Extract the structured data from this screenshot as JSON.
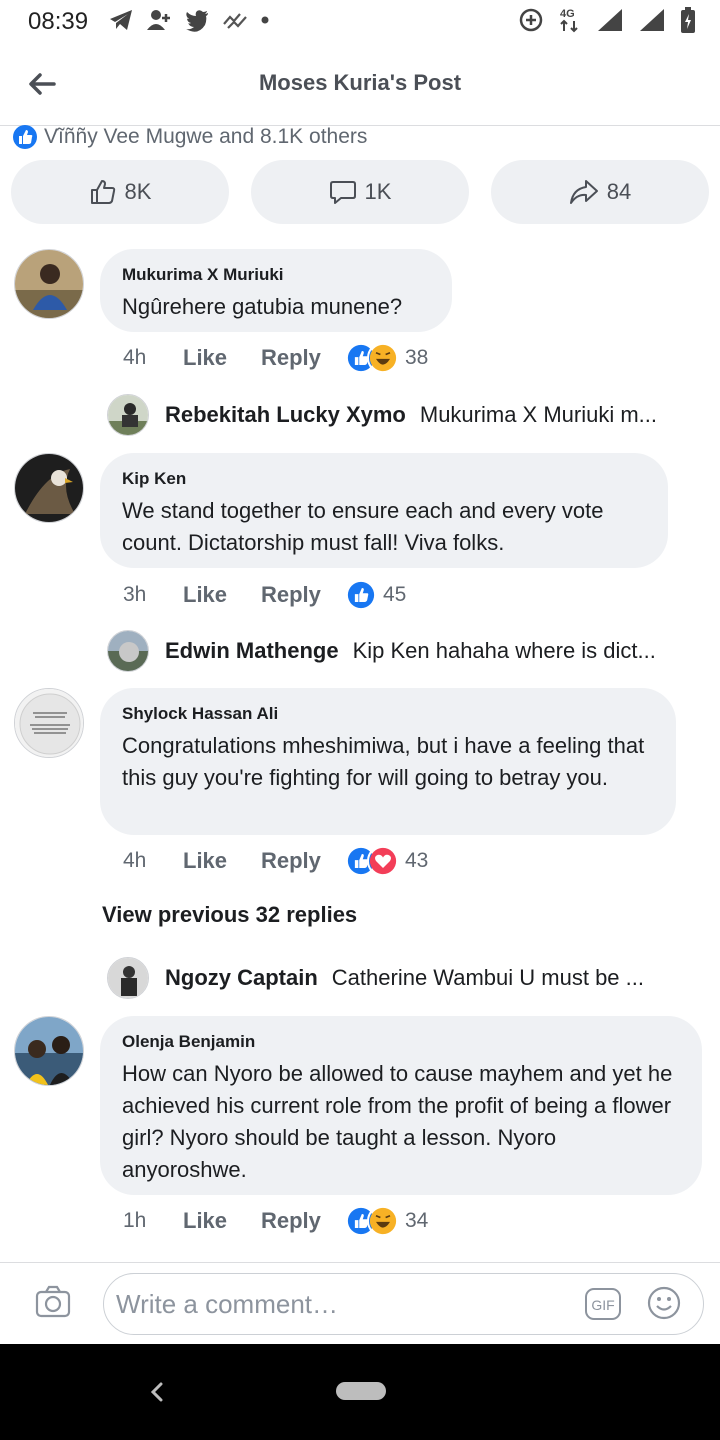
{
  "status_bar": {
    "time": "08:39",
    "network": "4G"
  },
  "header": {
    "title": "Moses Kuria's Post"
  },
  "reaction_summary": {
    "text": "Vĩññy Vee Mugwe and 8.1K others"
  },
  "actions": {
    "like_count": "8K",
    "comment_count": "1K",
    "share_count": "84"
  },
  "comments": [
    {
      "author": "Mukurima X Muriuki",
      "text": "Ngûrehere gatubia munene?",
      "time": "4h",
      "like_label": "Like",
      "reply_label": "Reply",
      "reaction_count": "38"
    },
    {
      "author": "Kip Ken",
      "text": "We stand together to ensure each and every vote count. Dictatorship must fall! Viva folks.",
      "time": "3h",
      "like_label": "Like",
      "reply_label": "Reply",
      "reaction_count": "45"
    },
    {
      "author": "Shylock Hassan Ali",
      "text": "Congratulations mheshimiwa, but i have a feeling that this guy you're fighting for will going to betray you.",
      "time": "4h",
      "like_label": "Like",
      "reply_label": "Reply",
      "reaction_count": "43"
    },
    {
      "author": "Olenja Benjamin",
      "text": "How can Nyoro be allowed to cause mayhem and yet he achieved his current role from the profit of being a flower girl? Nyoro should be taught a lesson. Nyoro anyoroshwe.",
      "time": "1h",
      "like_label": "Like",
      "reply_label": "Reply",
      "reaction_count": "34"
    }
  ],
  "replies": [
    {
      "author": "Rebekitah Lucky Xymo",
      "text": "Mukurima X Muriuki m..."
    },
    {
      "author": "Edwin Mathenge",
      "text": "Kip Ken hahaha where is dict..."
    },
    {
      "author": "Ngozy Captain",
      "text": "Catherine Wambui U must be ..."
    }
  ],
  "view_previous": "View previous 32 replies",
  "composer": {
    "placeholder": "Write a comment…",
    "gif_label": "GIF"
  },
  "colors": {
    "facebook_blue": "#1877f2",
    "bubble_bg": "#eff1f4",
    "meta_gray": "#606770",
    "love_red": "#f33e58",
    "haha_yellow": "#f7b125"
  }
}
